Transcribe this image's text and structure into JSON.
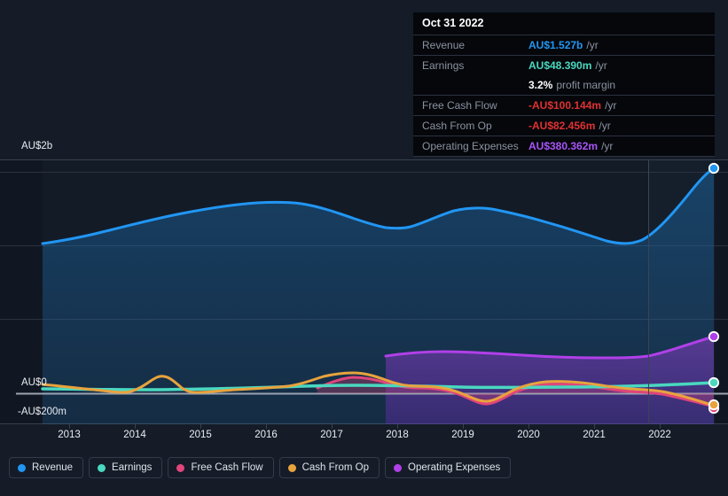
{
  "tooltip": {
    "title": "Oct 31 2022",
    "rows": [
      {
        "label": "Revenue",
        "value": "AU$1.527b",
        "unit": "/yr",
        "color": "#2196f3"
      },
      {
        "label": "Earnings",
        "value": "AU$48.390m",
        "unit": "/yr",
        "color": "#4ad8c0"
      },
      {
        "label": "",
        "value": "3.2%",
        "unit": "profit margin",
        "color": "#ffffff"
      },
      {
        "label": "Free Cash Flow",
        "value": "-AU$100.144m",
        "unit": "/yr",
        "color": "#e03131"
      },
      {
        "label": "Cash From Op",
        "value": "-AU$82.456m",
        "unit": "/yr",
        "color": "#e03131"
      },
      {
        "label": "Operating Expenses",
        "value": "AU$380.362m",
        "unit": "/yr",
        "color": "#a855f7"
      }
    ]
  },
  "legend": {
    "items": [
      {
        "label": "Revenue",
        "color": "#2196f3"
      },
      {
        "label": "Earnings",
        "color": "#4ad8c0"
      },
      {
        "label": "Free Cash Flow",
        "color": "#e0457b"
      },
      {
        "label": "Cash From Op",
        "color": "#e8a33d"
      },
      {
        "label": "Operating Expenses",
        "color": "#b040e8"
      }
    ]
  },
  "axes": {
    "y_top_label": "AU$2b",
    "y_zero_label": "AU$0",
    "y_bottom_label": "-AU$200m",
    "x_ticks": [
      "2013",
      "2014",
      "2015",
      "2016",
      "2017",
      "2018",
      "2019",
      "2020",
      "2021",
      "2022"
    ]
  },
  "chart_data": {
    "type": "area",
    "title": "",
    "xlabel": "",
    "ylabel": "",
    "currency": "AUD",
    "grid": true,
    "legend_position": "bottom",
    "ylim": [
      -200000000,
      2200000000
    ],
    "yticks": [
      {
        "value": 2000000000,
        "label": "AU$2b"
      },
      {
        "value": 0,
        "label": "AU$0"
      },
      {
        "value": -200000000,
        "label": "-AU$200m"
      }
    ],
    "x": [
      "2013",
      "2014",
      "2015",
      "2016",
      "2017",
      "2018",
      "2019",
      "2020",
      "2021",
      "2022"
    ],
    "forecast_divider_x": "2022",
    "series": [
      {
        "name": "Revenue",
        "color": "#2196f3",
        "filled": true,
        "values_aud": [
          1170000000,
          1230000000,
          1310000000,
          1400000000,
          1380000000,
          1300000000,
          1330000000,
          1290000000,
          1210000000,
          1527000000
        ],
        "end_value_label": "AU$1.527b"
      },
      {
        "name": "Earnings",
        "color": "#4ad8c0",
        "filled": true,
        "values_aud": [
          22000000,
          20000000,
          18000000,
          21000000,
          30000000,
          27000000,
          24000000,
          26000000,
          33000000,
          48390000
        ],
        "end_value_label": "AU$48.390m"
      },
      {
        "name": "Free Cash Flow",
        "color": "#e0457b",
        "filled": true,
        "values_aud": [
          null,
          null,
          null,
          null,
          60000000,
          30000000,
          -60000000,
          30000000,
          5000000,
          -100144000
        ],
        "end_value_label": "-AU$100.144m"
      },
      {
        "name": "Cash From Op",
        "color": "#e8a33d",
        "filled": true,
        "values_aud": [
          5000000,
          35000000,
          -5000000,
          0,
          75000000,
          45000000,
          -35000000,
          55000000,
          25000000,
          -82456000
        ],
        "end_value_label": "-AU$82.456m"
      },
      {
        "name": "Operating Expenses",
        "color": "#b040e8",
        "filled": true,
        "values_aud": [
          null,
          null,
          null,
          null,
          null,
          290000000,
          285000000,
          290000000,
          295000000,
          380362000
        ],
        "end_value_label": "AU$380.362m"
      }
    ]
  }
}
